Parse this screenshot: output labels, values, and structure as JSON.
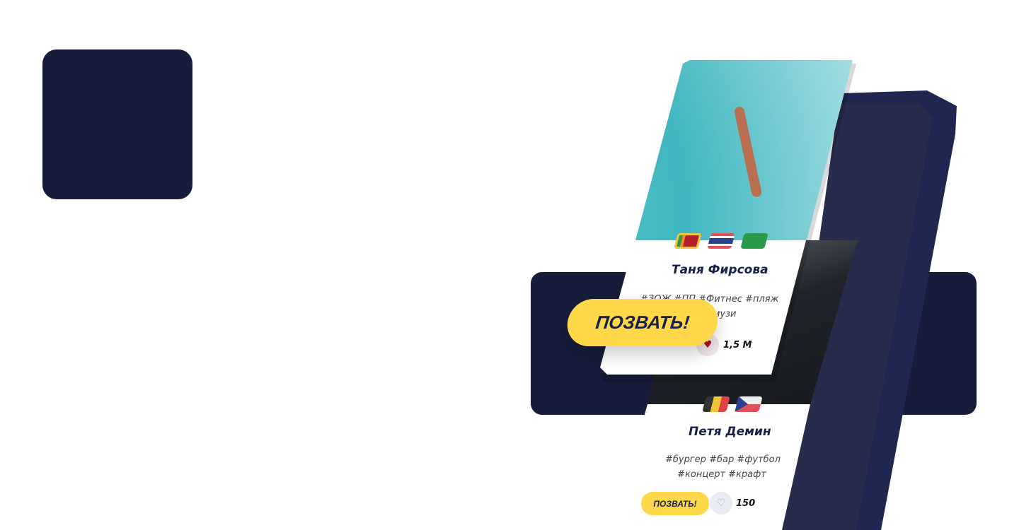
{
  "cards": [
    {
      "name": "Таня Фирсова",
      "tags_line1": "#ЗОЖ #ПП #Фитнес #пляж",
      "tags_line2": "#смузи",
      "likes": "1,5 M",
      "flags": [
        "sri-lanka",
        "thailand",
        "seychelles"
      ],
      "liked": true
    },
    {
      "name": "Петя Демин",
      "tags_line1": "#бургер #бар #футбол",
      "tags_line2": "#концерт #крафт",
      "likes": "150",
      "flags": [
        "belgium",
        "czech-republic"
      ],
      "liked": false
    }
  ],
  "cta_label": "ПОЗВАТЬ!",
  "colors": {
    "navy": "#171c3b",
    "yellow": "#ffd84a",
    "like_red": "#b3101e"
  }
}
